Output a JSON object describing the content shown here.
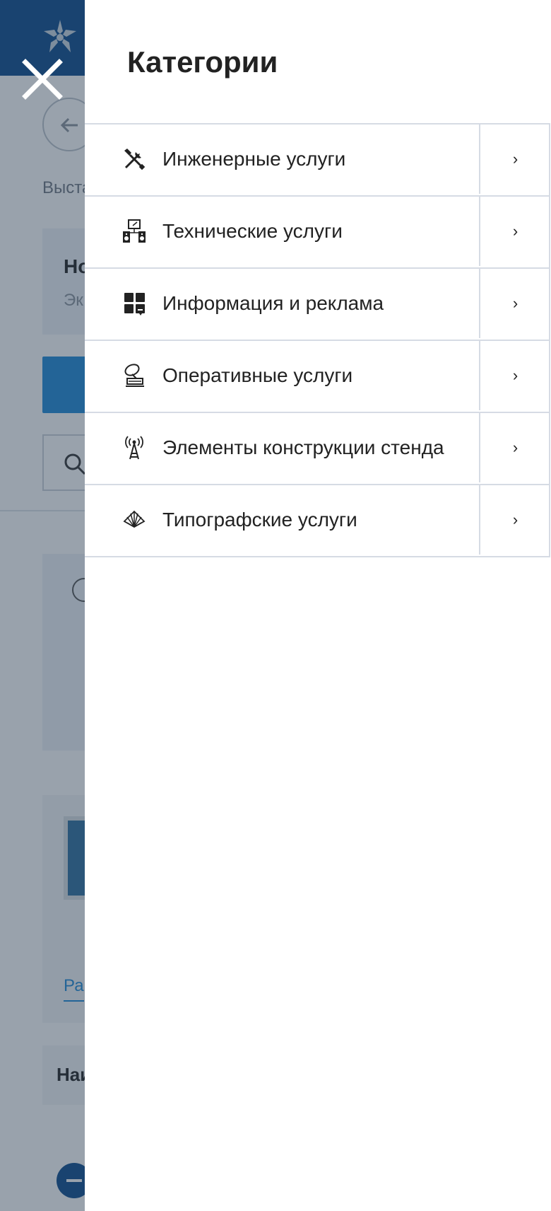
{
  "drawer": {
    "title": "Категории",
    "categories": [
      {
        "label": "Инженерные услуги",
        "icon": "tools-icon"
      },
      {
        "label": "Технические услуги",
        "icon": "speakers-screen-icon"
      },
      {
        "label": "Информация и реклама",
        "icon": "dashboard-grid-icon"
      },
      {
        "label": "Оперативные услуги",
        "icon": "satellite-dish-icon"
      },
      {
        "label": "Элементы конструкции стенда",
        "icon": "antenna-tower-icon"
      },
      {
        "label": "Типографские услуги",
        "icon": "fan-palette-icon"
      }
    ],
    "arrow_glyph": "›"
  },
  "background": {
    "crumb": "Выстав",
    "card_title": "Но",
    "card_sub": "Эк",
    "product_link": "Ра",
    "table_head": "Наи"
  },
  "colors": {
    "header": "#0a4a8c",
    "accent": "#1d89d6",
    "overlay": "rgba(42,60,82,0.48)",
    "divider": "#d6dbe4"
  }
}
